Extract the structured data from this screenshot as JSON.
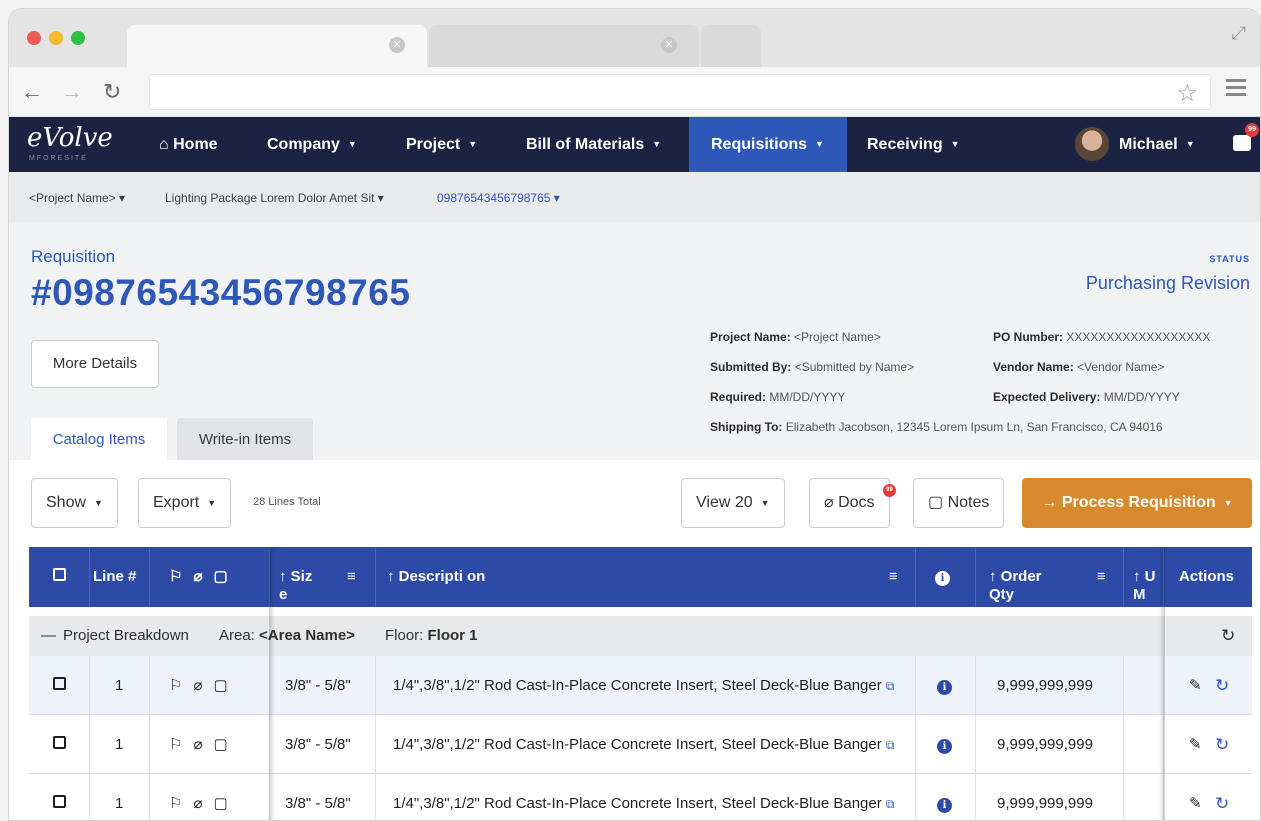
{
  "nav": {
    "logo": "eVolve",
    "logo_sub": "MFORESITE",
    "items": [
      {
        "label": "Home",
        "icon": "home-icon"
      },
      {
        "label": "Company"
      },
      {
        "label": "Project"
      },
      {
        "label": "Bill of Materials"
      },
      {
        "label": "Requisitions",
        "active": true
      },
      {
        "label": "Receiving"
      }
    ],
    "user": "Michael",
    "message_badge": "99"
  },
  "breadcrumb": {
    "project": "<Project Name>",
    "package": "Lighting Package Lorem Dolor Amet Sit",
    "requisition": "09876543456798765"
  },
  "header": {
    "label": "Requisition",
    "number": "#09876543456798765",
    "more_details": "More Details",
    "status_label": "STATUS",
    "status_value": "Purchasing Revision"
  },
  "meta": {
    "project_name_label": "Project Name:",
    "project_name": "<Project Name>",
    "submitted_by_label": "Submitted By:",
    "submitted_by": "<Submitted by Name>",
    "required_label": "Required:",
    "required": "MM/DD/YYYY",
    "shipping_label": "Shipping To:",
    "shipping": "Elizabeth Jacobson, 12345 Lorem Ipsum Ln, San Francisco, CA 94016",
    "po_label": "PO Number:",
    "po": "XXXXXXXXXXXXXXXXXX",
    "vendor_label": "Vendor Name:",
    "vendor": "<Vendor Name>",
    "delivery_label": "Expected Delivery:",
    "delivery": "MM/DD/YYYY"
  },
  "tabs": {
    "catalog": "Catalog Items",
    "writein": "Write-in Items"
  },
  "toolbar": {
    "show": "Show",
    "export": "Export",
    "lines_total": "28 Lines Total",
    "view": "View 20",
    "docs": "Docs",
    "docs_badge": "99",
    "notes": "Notes",
    "process": "Process Requisition"
  },
  "table": {
    "headers": {
      "line": "Line #",
      "size": "↑ Siz e",
      "description": "↑ Descripti on",
      "order_qty": "↑ Order Qty",
      "unit": "↑ U M",
      "actions": "Actions"
    },
    "group": {
      "breakdown": "Project Breakdown",
      "area_label": "Area:",
      "area": "<Area Name>",
      "floor_label": "Floor:",
      "floor": "Floor 1"
    },
    "rows": [
      {
        "line": "1",
        "size": "3/8\" - 5/8\"",
        "description": "1/4\",3/8\",1/2\" Rod Cast-In-Place Concrete Insert, Steel Deck-Blue Banger",
        "qty": "9,999,999,999"
      },
      {
        "line": "1",
        "size": "3/8\" - 5/8\"",
        "description": "1/4\",3/8\",1/2\" Rod Cast-In-Place Concrete Insert, Steel Deck-Blue Banger",
        "qty": "9,999,999,999"
      },
      {
        "line": "1",
        "size": "3/8\" - 5/8\"",
        "description": "1/4\",3/8\",1/2\" Rod Cast-In-Place Concrete Insert, Steel Deck-Blue Banger",
        "qty": "9,999,999,999"
      }
    ]
  },
  "colors": {
    "navy": "#1c2242",
    "primary": "#2d57b8",
    "table_header": "#2d4ba6",
    "orange": "#d9892d"
  }
}
